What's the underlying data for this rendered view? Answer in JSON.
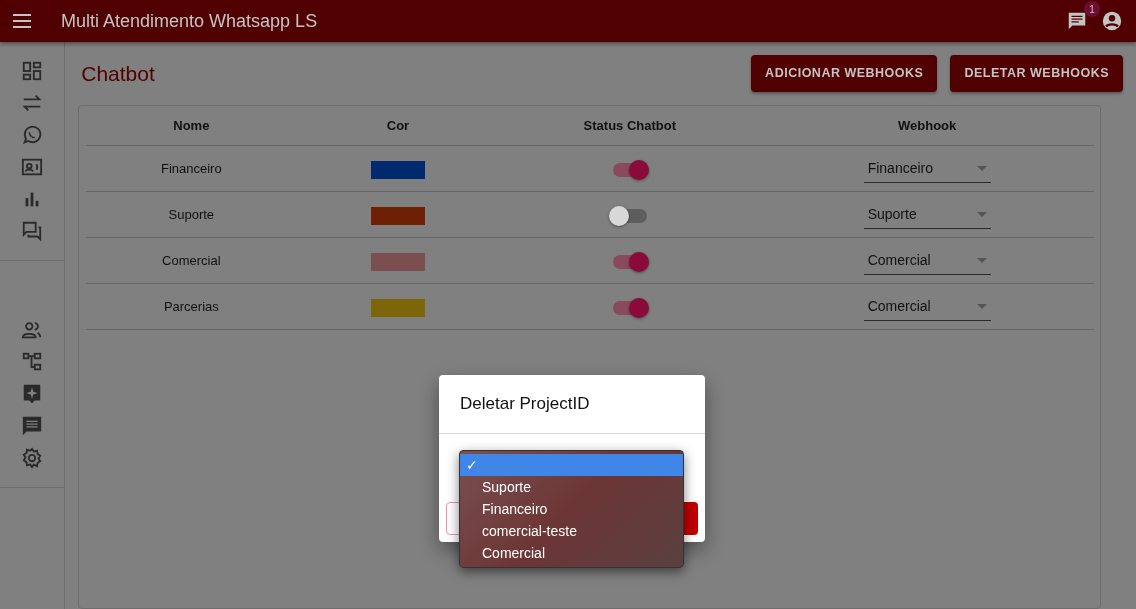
{
  "app_bar": {
    "title": "Multi Atendimento Whatsapp LS",
    "notification_badge": "1"
  },
  "page": {
    "title": "Chatbot",
    "buttons": [
      "ADICIONAR WEBHOOKS",
      "DELETAR WEBHOOKS"
    ]
  },
  "table": {
    "columns": [
      "Nome",
      "Cor",
      "Status Chatbot",
      "Webhook"
    ],
    "rows": [
      {
        "name": "Financeiro",
        "color": "#002a6e",
        "on": true,
        "webhook": "Financeiro"
      },
      {
        "name": "Suporte",
        "color": "#6e2005",
        "on": false,
        "webhook": "Suporte"
      },
      {
        "name": "Comercial",
        "color": "#7b4f4f",
        "on": true,
        "webhook": "Comercial"
      },
      {
        "name": "Parcerias",
        "color": "#7d6509",
        "on": true,
        "webhook": "Comercial"
      }
    ]
  },
  "dialog": {
    "title": "Deletar ProjectID",
    "dropdown": {
      "check_mark": "✓",
      "options": [
        {
          "selected": true
        },
        {
          "label": "Suporte",
          "selected": false
        },
        {
          "label": "Financeiro",
          "selected": false
        },
        {
          "label": "comercial-teste",
          "selected": false
        },
        {
          "label": "Comercial",
          "selected": false
        }
      ]
    }
  }
}
